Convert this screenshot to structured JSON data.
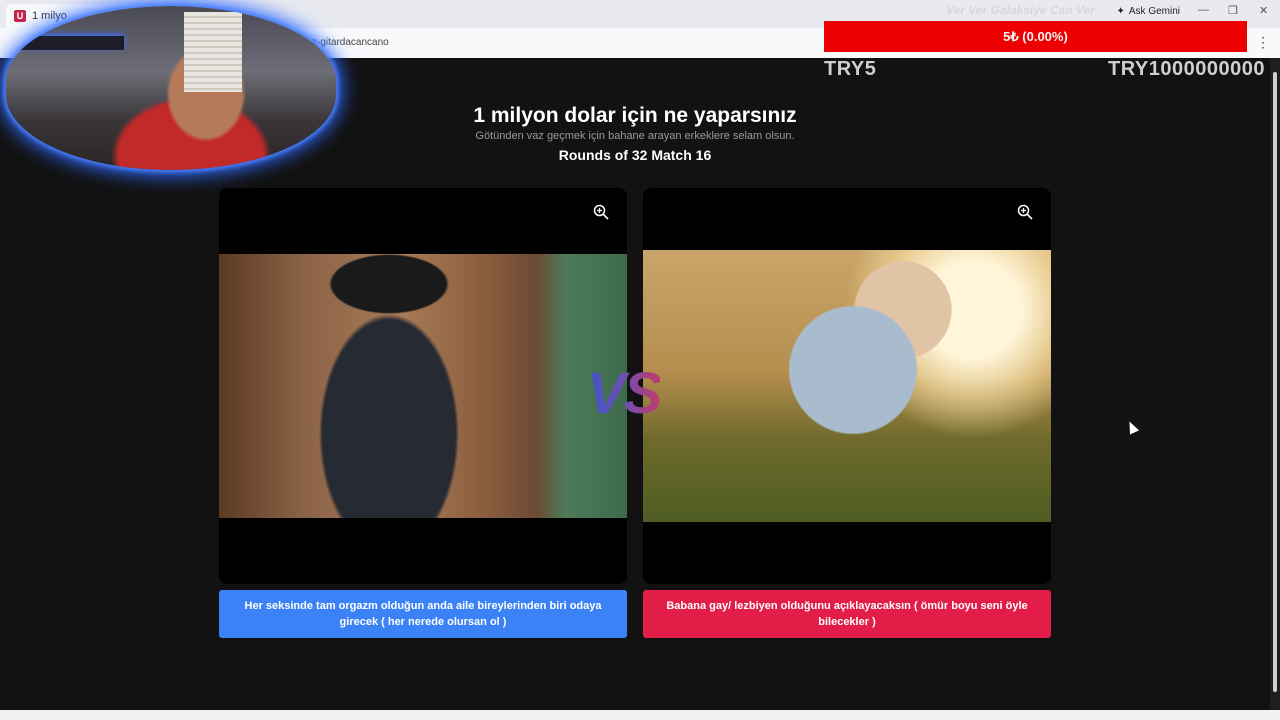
{
  "browser": {
    "tab_title": "1 milyo",
    "favicon": "U",
    "url": "z-gitardacancano",
    "ask_gemini": "Ask Gemini",
    "menu_icon": "kebab-menu-icon",
    "window_controls": [
      "—",
      "❐",
      "✕"
    ]
  },
  "page": {
    "title": "1 milyon dolar için ne yaparsınız",
    "subtitle": "Götünden vaz geçmek için bahane arayan erkeklere selam olsun.",
    "round": "Rounds of 32 Match 16",
    "vs": "VS",
    "zoom_icon": "zoom-in-icon",
    "choices": [
      {
        "label": "Her seksinde tam orgazm olduğun anda aile bireylerinden biri odaya girecek ( her nerede olursan ol )",
        "color": "#3b82f6"
      },
      {
        "label": "Babana gay/ lezbiyen olduğunu açıklayacaksın ( ömür boyu seni öyle bilecekler )",
        "color": "#e11d48"
      }
    ]
  },
  "overlay": {
    "marquee": "Ver Ver Galaksiye Can Ver",
    "donation": "5₺ (0.00%)",
    "goal_min": "TRY5",
    "goal_max": "TRY1000000000"
  }
}
